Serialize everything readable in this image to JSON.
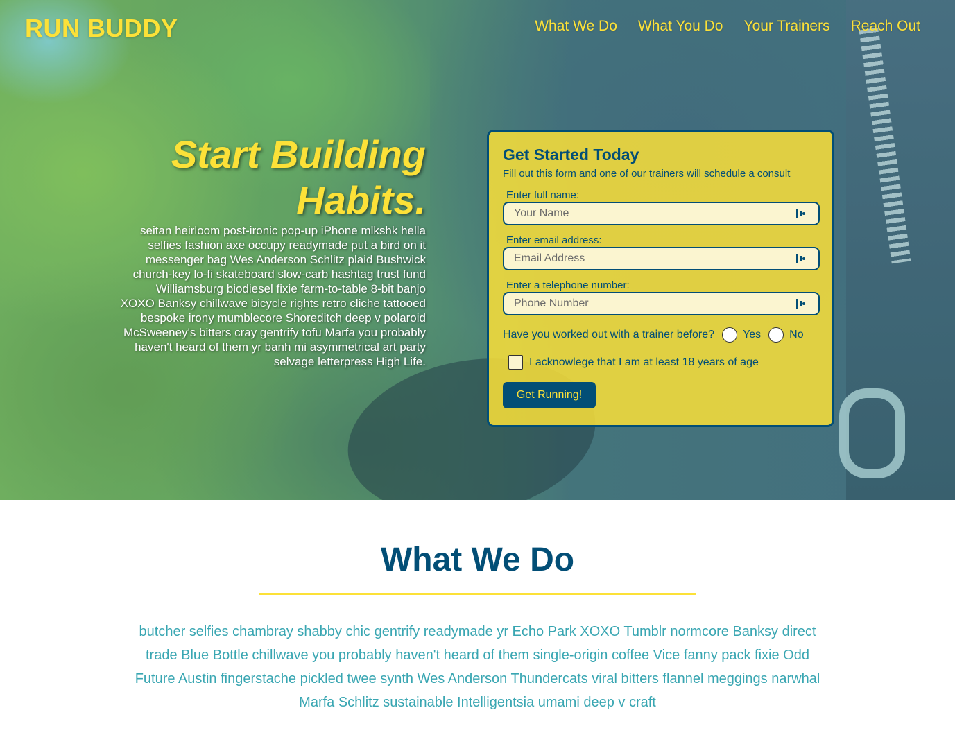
{
  "header": {
    "brand": "RUN BUDDY",
    "nav": [
      {
        "label": "What We Do"
      },
      {
        "label": "What You Do"
      },
      {
        "label": "Your Trainers"
      },
      {
        "label": "Reach Out"
      }
    ]
  },
  "hero": {
    "title_line1": "Start Building",
    "title_line2": "Habits.",
    "text": "seitan heirloom post-ironic pop-up iPhone mlkshk hella selfies fashion axe occupy readymade put a bird on it messenger bag Wes Anderson Schlitz plaid Bushwick church-key lo-fi skateboard slow-carb hashtag trust fund Williamsburg biodiesel fixie farm-to-table 8-bit banjo XOXO Banksy chillwave bicycle rights retro cliche tattooed bespoke irony mumblecore Shoreditch deep v polaroid McSweeney's bitters cray gentrify tofu Marfa you probably haven't heard of them yr banh mi asymmetrical art party selvage letterpress High Life."
  },
  "form": {
    "title": "Get Started Today",
    "subtitle": "Fill out this form and one of our trainers will schedule a consult",
    "name_label": "Enter full name:",
    "name_placeholder": "Your Name",
    "email_label": "Enter email address:",
    "email_placeholder": "Email Address",
    "phone_label": "Enter a telephone number:",
    "phone_placeholder": "Phone Number",
    "question": "Have you worked out with a trainer before?",
    "yes_label": "Yes",
    "no_label": "No",
    "checkbox_label": "I acknowlege that I am at least 18 years of age",
    "submit_label": "Get Running!"
  },
  "what_we_do": {
    "title": "What We Do",
    "text": "butcher selfies chambray shabby chic gentrify readymade yr Echo Park XOXO Tumblr normcore Banksy direct trade Blue Bottle chillwave you probably haven't heard of them single-origin coffee Vice fanny pack fixie Odd Future Austin fingerstache pickled twee synth Wes Anderson Thundercats viral bitters flannel meggings narwhal Marfa Schlitz sustainable Intelligentsia umami deep v craft"
  },
  "colors": {
    "yellow": "#fce138",
    "navy": "#024e76",
    "teal": "#39a6b2"
  },
  "icons": {
    "field_icon": "autofill-icon"
  }
}
